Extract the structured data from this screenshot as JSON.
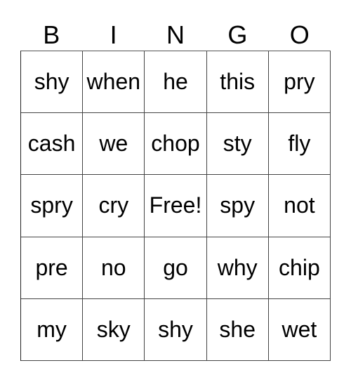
{
  "card": {
    "header": [
      "B",
      "I",
      "N",
      "G",
      "O"
    ],
    "rows": [
      [
        "shy",
        "when",
        "he",
        "this",
        "pry"
      ],
      [
        "cash",
        "we",
        "chop",
        "sty",
        "fly"
      ],
      [
        "spry",
        "cry",
        "Free!",
        "spy",
        "not"
      ],
      [
        "pre",
        "no",
        "go",
        "why",
        "chip"
      ],
      [
        "my",
        "sky",
        "shy",
        "she",
        "wet"
      ]
    ],
    "free_space_label": "Free!"
  }
}
